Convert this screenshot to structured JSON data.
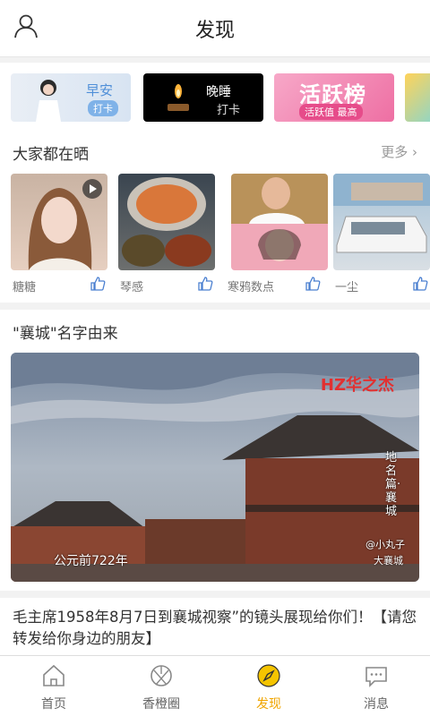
{
  "header": {
    "title": "发现",
    "profile_icon": "person-icon"
  },
  "banners": [
    {
      "title": "早安",
      "tag": "打卡"
    },
    {
      "title": "晚睡",
      "tag": "打卡"
    },
    {
      "title": "活跃榜",
      "tag": "活跃值 最高"
    }
  ],
  "shared": {
    "title": "大家都在晒",
    "more": "更多",
    "items": [
      {
        "name": "糖糖"
      },
      {
        "name": "琴感"
      },
      {
        "name": "寒鸦数点"
      },
      {
        "name": "一尘"
      }
    ]
  },
  "video_post": {
    "title": "\"襄城\"名字由来",
    "brand": "HZ华之杰",
    "caption": "公元前722年",
    "vertical_text": "地名篇·襄城",
    "watermark_author": "@小丸子",
    "watermark_place": "大襄城"
  },
  "article": {
    "text": "毛主席1958年8月7日到襄城视察”的镜头展现给你们！【请您转发给你身边的朋友】"
  },
  "tabs": [
    {
      "label": "首页"
    },
    {
      "label": "香橙圈"
    },
    {
      "label": "发现"
    },
    {
      "label": "消息"
    }
  ],
  "colors": {
    "accent": "#f0a500",
    "brand_red": "#e23030"
  }
}
